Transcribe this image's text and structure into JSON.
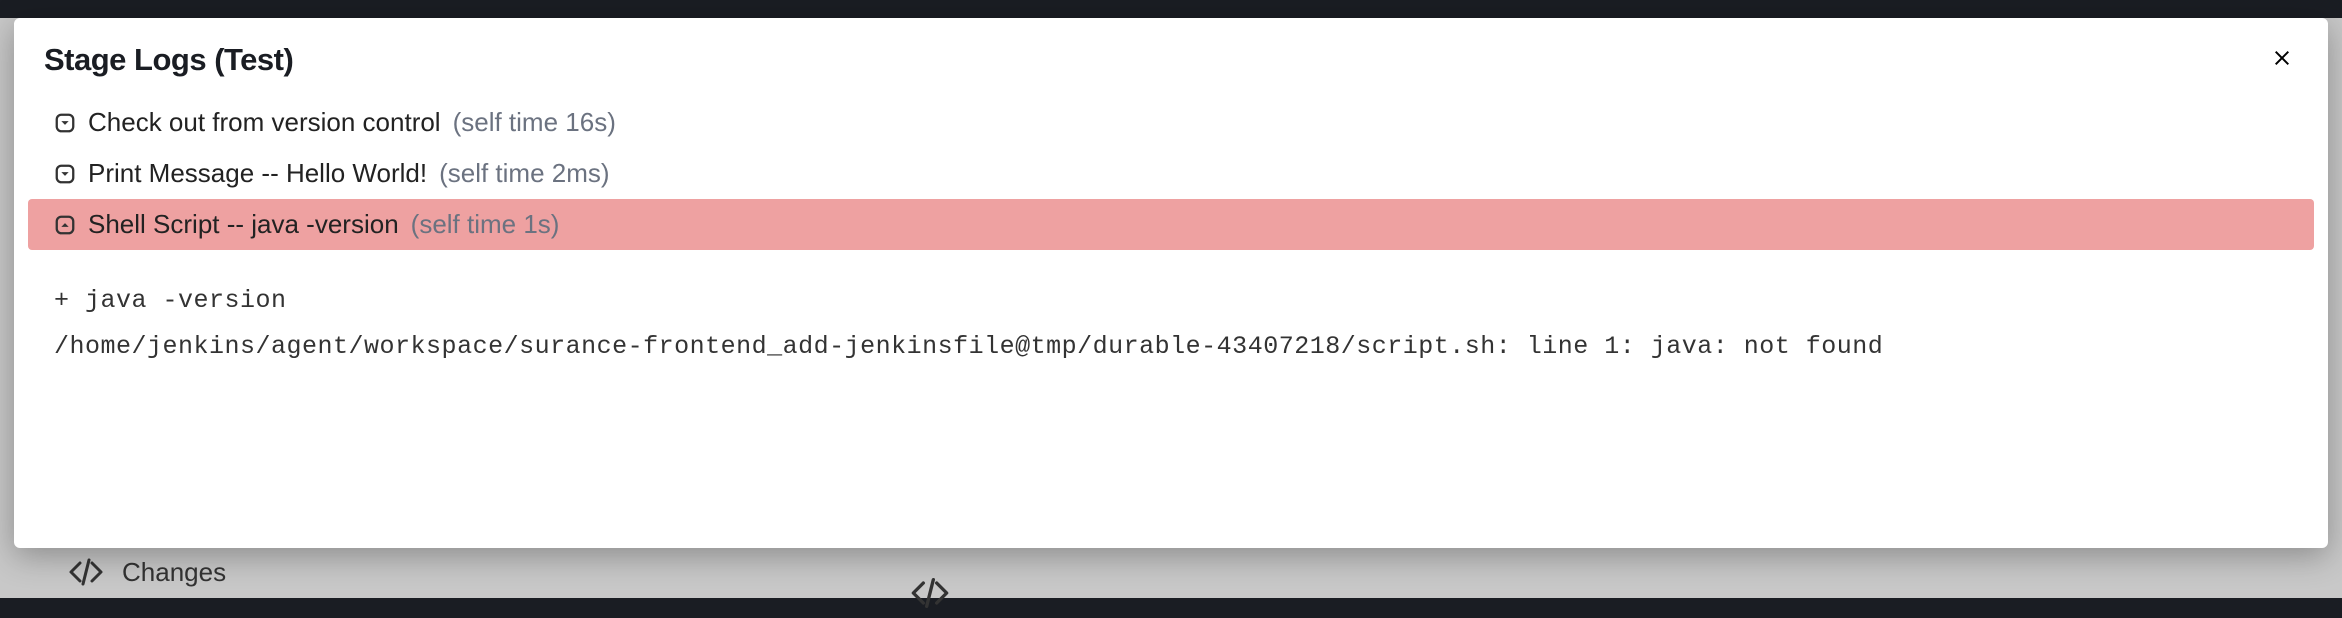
{
  "modal": {
    "title": "Stage Logs (Test)"
  },
  "steps": [
    {
      "label": "Check out from version control",
      "time": "(self time 16s)",
      "expanded": false,
      "error": false
    },
    {
      "label": "Print Message -- Hello World!",
      "time": "(self time 2ms)",
      "expanded": false,
      "error": false
    },
    {
      "label": "Shell Script -- java -version",
      "time": "(self time 1s)",
      "expanded": true,
      "error": true
    }
  ],
  "console": "+ java -version\n/home/jenkins/agent/workspace/surance-frontend_add-jenkinsfile@tmp/durable-43407218/script.sh: line 1: java: not found",
  "backdrop": {
    "changes_label": "Changes"
  }
}
